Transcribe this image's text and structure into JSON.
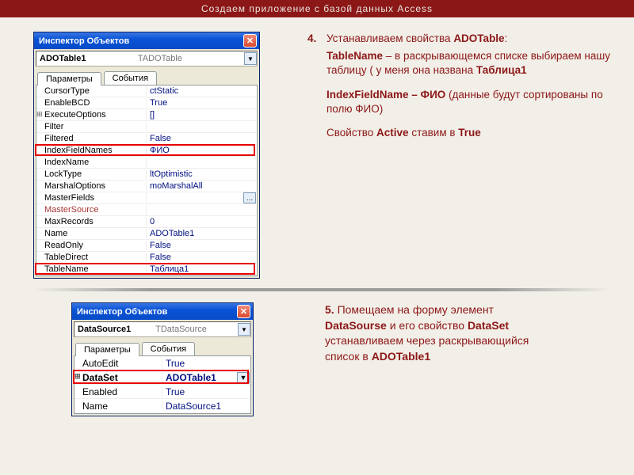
{
  "slide_title": "Создаем приложение с базой данных Access",
  "inspector1": {
    "title": "Инспектор Объектов",
    "sel_name": "ADOTable1",
    "sel_class": "TADOTable",
    "tab_params": "Параметры",
    "tab_events": "События",
    "rows": [
      {
        "p": "CursorType",
        "v": "ctStatic"
      },
      {
        "p": "EnableBCD",
        "v": "True"
      },
      {
        "p": "ExecuteOptions",
        "v": "[]",
        "expand": true
      },
      {
        "p": "Filter",
        "v": ""
      },
      {
        "p": "Filtered",
        "v": "False"
      },
      {
        "p": "IndexFieldNames",
        "v": "ФИО",
        "hl": true
      },
      {
        "p": "IndexName",
        "v": ""
      },
      {
        "p": "LockType",
        "v": "ltOptimistic"
      },
      {
        "p": "MarshalOptions",
        "v": "moMarshalAll"
      },
      {
        "p": "MasterFields",
        "v": "",
        "ell": true
      },
      {
        "p": "MasterSource",
        "v": "",
        "linkred": true
      },
      {
        "p": "MaxRecords",
        "v": "0"
      },
      {
        "p": "Name",
        "v": "ADOTable1"
      },
      {
        "p": "ReadOnly",
        "v": "False"
      },
      {
        "p": "TableDirect",
        "v": "False"
      },
      {
        "p": "TableName",
        "v": "Таблица1",
        "hl": true
      }
    ]
  },
  "inspector2": {
    "title": "Инспектор Объектов",
    "sel_name": "DataSource1",
    "sel_class": "TDataSource",
    "tab_params": "Параметры",
    "tab_events": "События",
    "rows": [
      {
        "p": "AutoEdit",
        "v": "True"
      },
      {
        "p": "DataSet",
        "v": "ADOTable1",
        "expand": true,
        "sel": true,
        "hl": true
      },
      {
        "p": "Enabled",
        "v": "True"
      },
      {
        "p": "Name",
        "v": "DataSource1"
      }
    ]
  },
  "step4": {
    "num": "4.",
    "head1a": "Устанавливаем свойства ",
    "head1b": "ADOTable",
    "p1a": "TableName",
    "p1b": " – в раскрывающемся списке выбираем нашу таблицу ( у меня она названа ",
    "p1c": "Таблица1",
    "p2a": "IndexFieldName – ФИО",
    "p2b": " (данные будут сортированы по полю ФИО)",
    "p3a": "Свойство ",
    "p3b": "Active",
    "p3c": " ставим в ",
    "p3d": "True"
  },
  "step5": {
    "num": "5.",
    "t1": "Помещаем на форму элемент ",
    "t2": "DataSourse",
    "t3": " и его свойство ",
    "t4": "DataSet",
    "t5": " устанавливаем через раскрывающийся список в ",
    "t6": "ADOTable1"
  }
}
